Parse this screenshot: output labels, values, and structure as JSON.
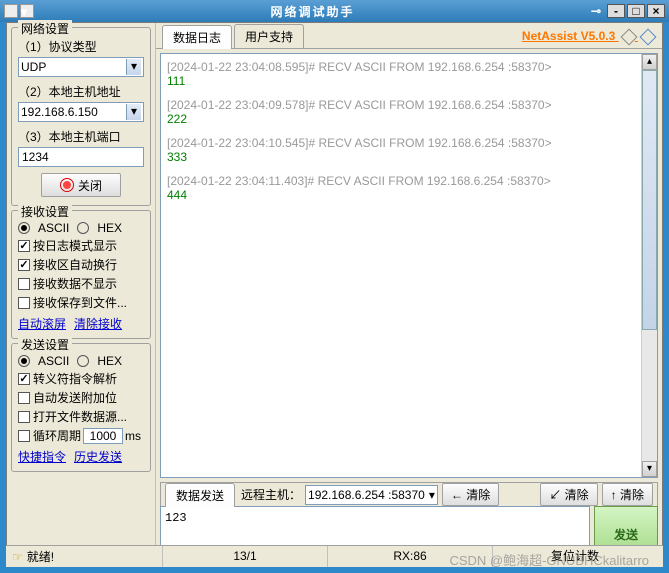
{
  "title": "网络调试助手",
  "version_label": "NetAssist V5.0.3",
  "network_settings": {
    "title": "网络设置",
    "protocol_label": "（1）协议类型",
    "protocol_value": "UDP",
    "host_label": "（2）本地主机地址",
    "host_value": "192.168.6.150",
    "port_label": "（3）本地主机端口",
    "port_value": "1234",
    "close_btn": "关闭"
  },
  "recv_settings": {
    "title": "接收设置",
    "ascii": "ASCII",
    "hex": "HEX",
    "log_mode": "按日志模式显示",
    "auto_wrap": "接收区自动换行",
    "hide_recv": "接收数据不显示",
    "save_file": "接收保存到文件...",
    "auto_scroll": "自动滚屏",
    "clear_recv": "清除接收"
  },
  "send_settings": {
    "title": "发送设置",
    "ascii": "ASCII",
    "hex": "HEX",
    "escape": "转义符指令解析",
    "auto_append": "自动发送附加位",
    "open_file": "打开文件数据源...",
    "loop_label_pre": "循环周期",
    "loop_value": "1000",
    "loop_unit": "ms",
    "shortcut": "快捷指令",
    "history": "历史发送"
  },
  "tabs": {
    "log": "数据日志",
    "support": "用户支持"
  },
  "log": [
    {
      "head": "[2024-01-22 23:04:08.595]# RECV ASCII FROM 192.168.6.254 :58370>",
      "data": "111"
    },
    {
      "head": "[2024-01-22 23:04:09.578]# RECV ASCII FROM 192.168.6.254 :58370>",
      "data": "222"
    },
    {
      "head": "[2024-01-22 23:04:10.545]# RECV ASCII FROM 192.168.6.254 :58370>",
      "data": "333"
    },
    {
      "head": "[2024-01-22 23:04:11.403]# RECV ASCII FROM 192.168.6.254 :58370>",
      "data": "444"
    }
  ],
  "send_area": {
    "tab": "数据发送",
    "remote_label": "远程主机：",
    "remote_value": "192.168.6.254 :58370",
    "clear_left": "清除",
    "clear_right1": "清除",
    "clear_right2": "清除",
    "input": "123",
    "send_btn": "发送"
  },
  "status": {
    "ready": "就绪!",
    "count": "13/1",
    "rx": "RX:86",
    "tx": "复位计数",
    "watermark": "CSDN @鲍海超-GNUBHCkalitarro"
  }
}
